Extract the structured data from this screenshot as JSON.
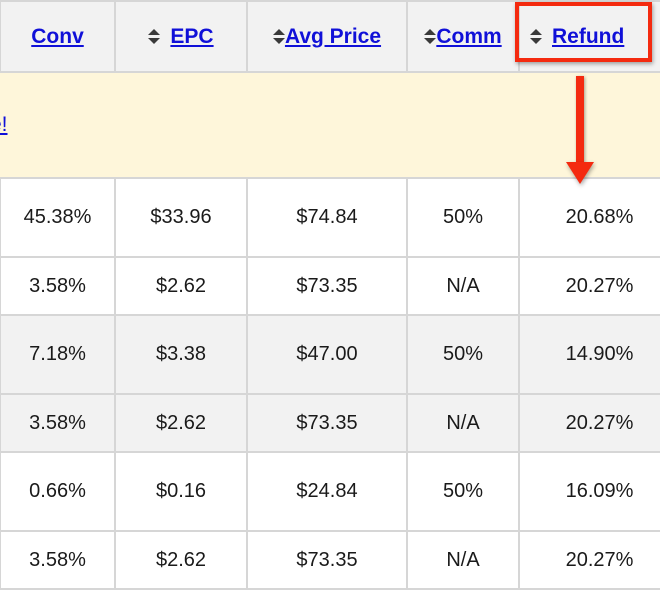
{
  "table": {
    "columns": [
      {
        "key": "conv",
        "label": "Conv",
        "sortable": false
      },
      {
        "key": "epc",
        "label": "EPC",
        "sortable": true
      },
      {
        "key": "avg_price",
        "label": "Avg Price",
        "sortable": true
      },
      {
        "key": "comm",
        "label": "Comm",
        "sortable": true
      },
      {
        "key": "refund",
        "label": "Refund",
        "sortable": true
      }
    ],
    "banner_link": "e!",
    "rows": [
      {
        "conv": "45.38%",
        "epc": "$33.96",
        "avg_price": "$74.84",
        "comm": "50%",
        "refund": "20.68%"
      },
      {
        "conv": "3.58%",
        "epc": "$2.62",
        "avg_price": "$73.35",
        "comm": "N/A",
        "refund": "20.27%"
      },
      {
        "conv": "7.18%",
        "epc": "$3.38",
        "avg_price": "$47.00",
        "comm": "50%",
        "refund": "14.90%"
      },
      {
        "conv": "3.58%",
        "epc": "$2.62",
        "avg_price": "$73.35",
        "comm": "N/A",
        "refund": "20.27%"
      },
      {
        "conv": "0.66%",
        "epc": "$0.16",
        "avg_price": "$24.84",
        "comm": "50%",
        "refund": "16.09%"
      },
      {
        "conv": "3.58%",
        "epc": "$2.62",
        "avg_price": "$73.35",
        "comm": "N/A",
        "refund": "20.27%"
      }
    ]
  },
  "annotation": {
    "highlighted_column": "Refund",
    "color": "#f42a0f"
  }
}
